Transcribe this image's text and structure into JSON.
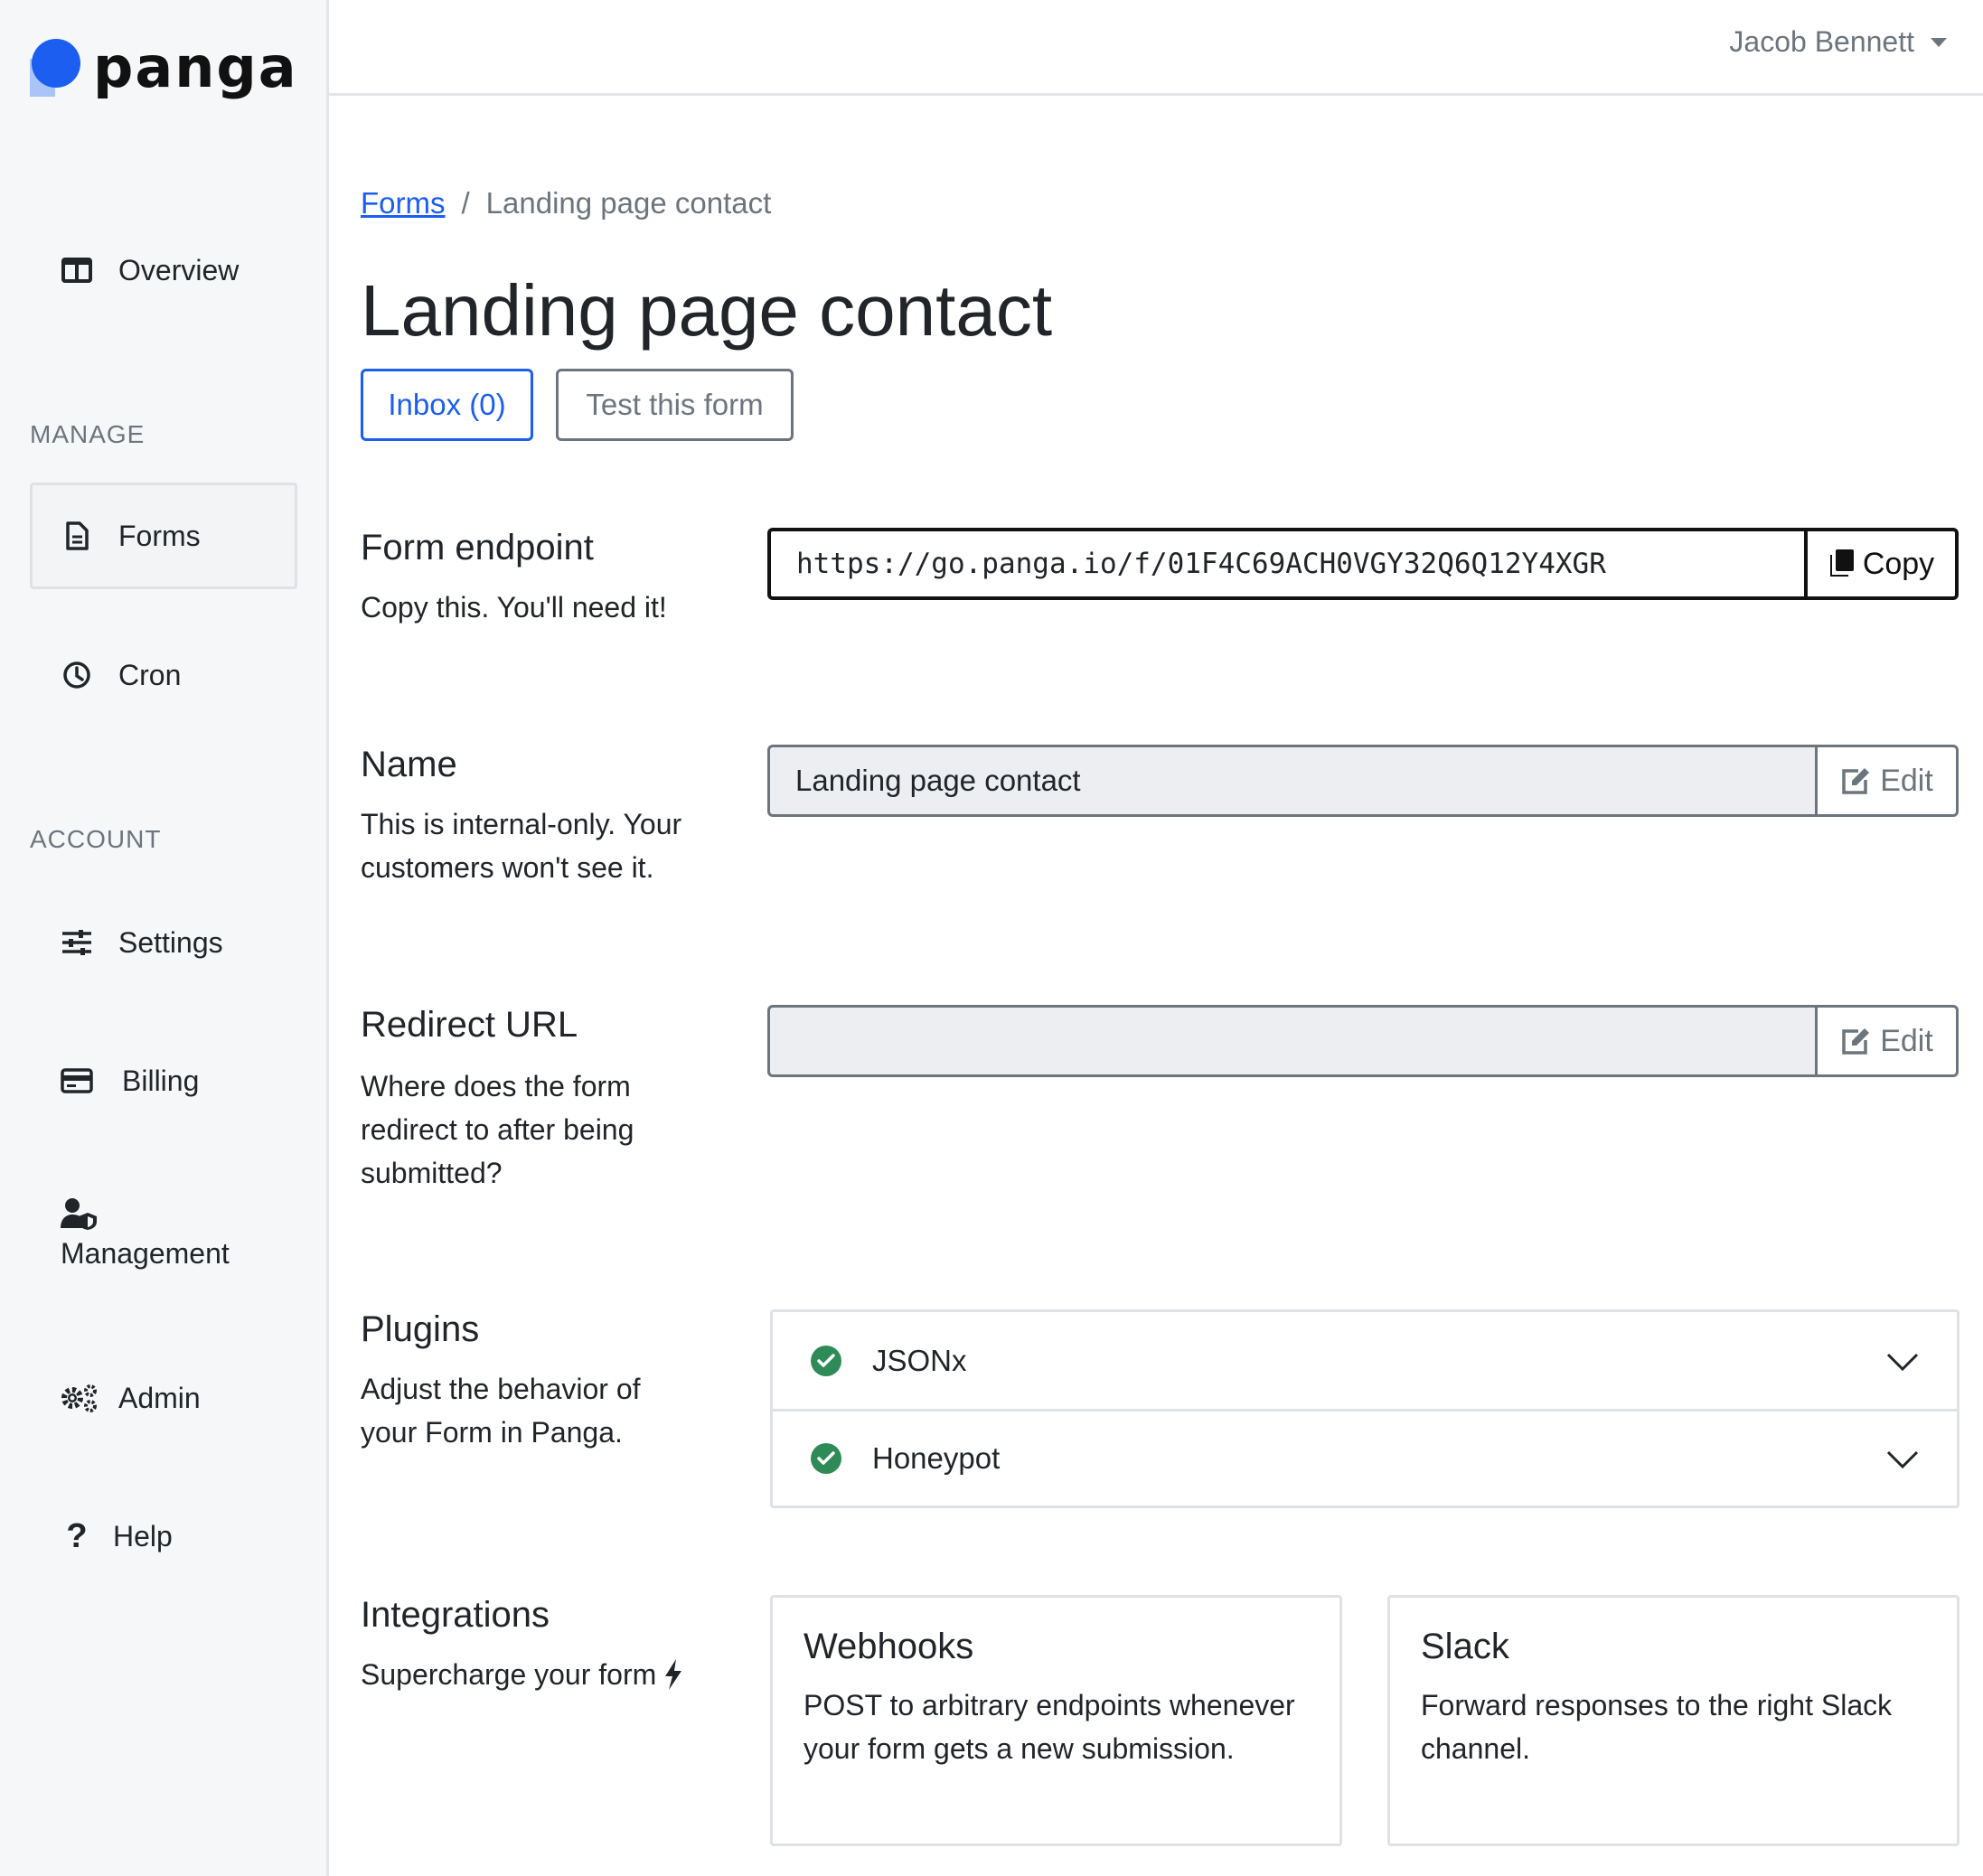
{
  "brand": {
    "name": "panga"
  },
  "sidebar": {
    "overview": {
      "label": "Overview"
    },
    "sections": {
      "manage": "MANAGE",
      "account": "ACCOUNT"
    },
    "manage_items": [
      {
        "label": "Forms",
        "icon": "file-icon",
        "active": true
      },
      {
        "label": "Cron",
        "icon": "clock-icon",
        "active": false
      }
    ],
    "account_items": [
      {
        "label": "Settings",
        "icon": "sliders-icon"
      },
      {
        "label": "Billing",
        "icon": "credit-card-icon"
      },
      {
        "label": "Management",
        "icon": "user-shield-icon"
      },
      {
        "label": "Admin",
        "icon": "gears-icon"
      },
      {
        "label": "Help",
        "icon": "question-icon"
      }
    ]
  },
  "header": {
    "user_name": "Jacob Bennett"
  },
  "breadcrumb": {
    "parent": "Forms",
    "separator": "/",
    "current": "Landing page contact"
  },
  "page": {
    "title": "Landing page contact",
    "inbox_button": "Inbox (0)",
    "test_button": "Test this form"
  },
  "form_endpoint": {
    "title": "Form endpoint",
    "description": "Copy this. You'll need it!",
    "value": "https://go.panga.io/f/01F4C69ACH0VGY32Q6Q12Y4XGR",
    "button": "Copy"
  },
  "name_field": {
    "title": "Name",
    "description": "This is internal-only. Your customers won't see it.",
    "value": "Landing page contact",
    "button": "Edit"
  },
  "redirect_field": {
    "title": "Redirect URL",
    "description": "Where does the form redirect to after being submitted?",
    "value": "",
    "button": "Edit"
  },
  "plugins": {
    "title": "Plugins",
    "description": "Adjust the behavior of your Form in Panga.",
    "items": [
      {
        "name": "JSONx",
        "enabled": true
      },
      {
        "name": "Honeypot",
        "enabled": true
      }
    ]
  },
  "integrations": {
    "title": "Integrations",
    "description": "Supercharge your form",
    "cards": [
      {
        "title": "Webhooks",
        "text": "POST to arbitrary endpoints whenever your form gets a new submission."
      },
      {
        "title": "Slack",
        "text": "Forward responses to the right Slack channel."
      }
    ]
  },
  "colors": {
    "accent": "#1b5ef0",
    "success": "#2e8b57",
    "muted": "#6c757d",
    "sidebar_bg": "#f6f7f9"
  }
}
